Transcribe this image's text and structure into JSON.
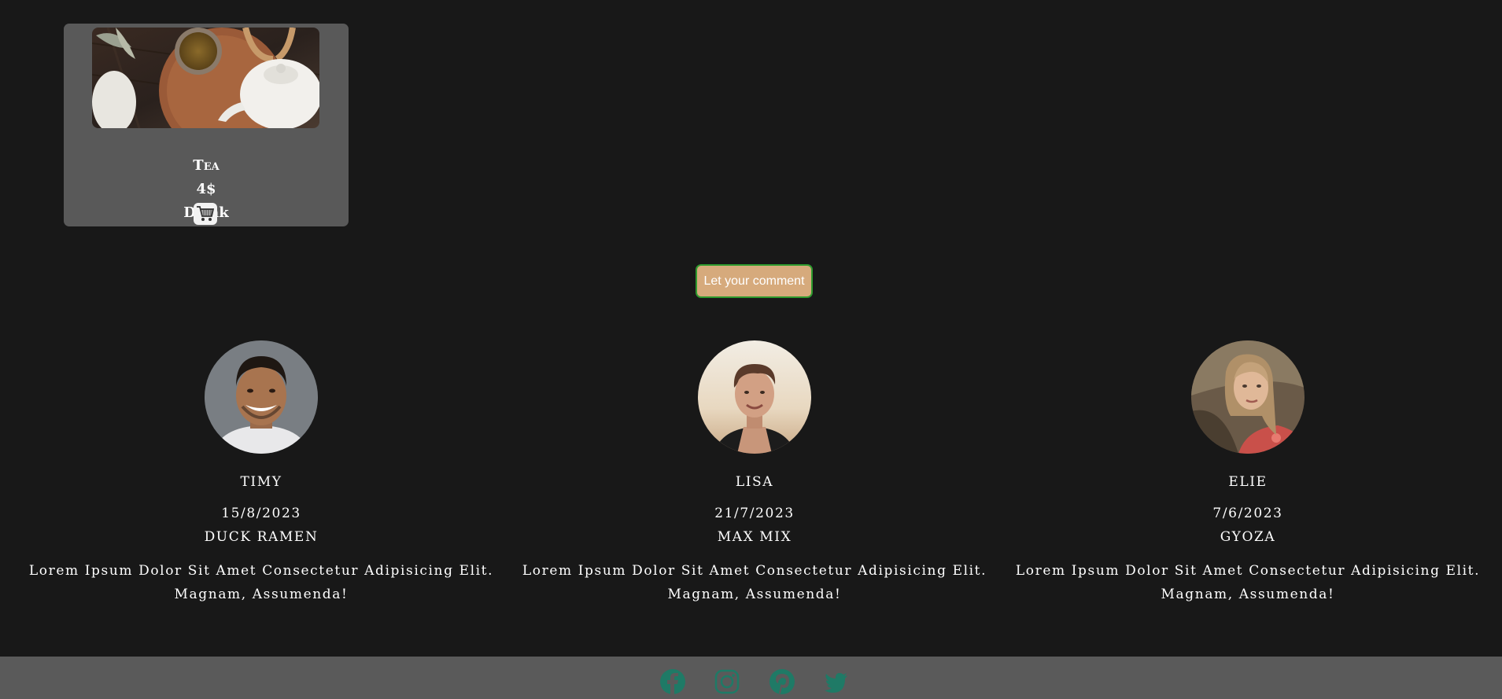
{
  "product": {
    "name": "Tea",
    "price": "4$",
    "category": "Drink",
    "image_icon": "tea-photo",
    "cart_icon": "cart-icon"
  },
  "comment_button": {
    "label": "Let your comment"
  },
  "reviews": [
    {
      "name": "Timy",
      "date": "15/8/2023",
      "dish": "Duck Ramen",
      "text": "Lorem Ipsum Dolor Sit Amet Consectetur Adipisicing Elit. Magnam, Assumenda!"
    },
    {
      "name": "Lisa",
      "date": "21/7/2023",
      "dish": "Max Mix",
      "text": "Lorem Ipsum Dolor Sit Amet Consectetur Adipisicing Elit. Magnam, Assumenda!"
    },
    {
      "name": "Elie",
      "date": "7/6/2023",
      "dish": "Gyoza",
      "text": "Lorem Ipsum Dolor Sit Amet Consectetur Adipisicing Elit. Magnam, Assumenda!"
    }
  ],
  "footer": {
    "icons": [
      "facebook-icon",
      "instagram-icon",
      "pinterest-icon",
      "twitter-icon"
    ]
  },
  "colors": {
    "background": "#181818",
    "card": "#595959",
    "comment_button": "#d6aa7c",
    "comment_border": "#2e9a2e",
    "footer": "#5a5a5a",
    "social_icon": "#1f7a66"
  }
}
